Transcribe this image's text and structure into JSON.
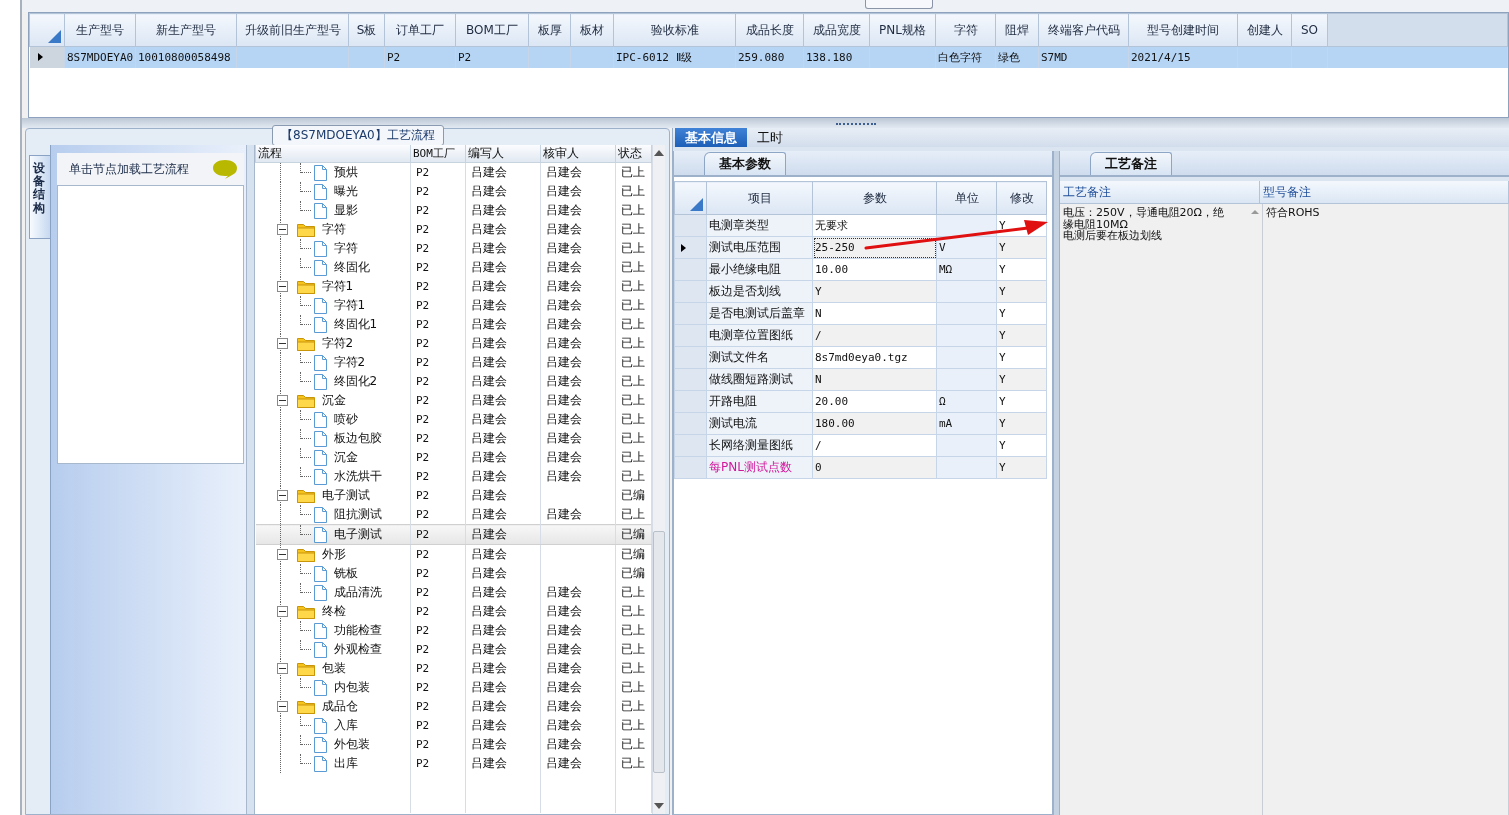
{
  "model_grid": {
    "columns": [
      "生产型号",
      "新生产型号",
      "升级前旧生产型号",
      "S板",
      "订单工厂",
      "BOM工厂",
      "板厚",
      "板材",
      "验收标准",
      "成品长度",
      "成品宽度",
      "PNL规格",
      "字符",
      "阻焊",
      "终端客户代码",
      "型号创建时间",
      "创建人",
      "SO"
    ],
    "rows": [
      {
        "selected": true,
        "cells": [
          "8S7MDOEYA0",
          "10010800058498",
          null,
          null,
          "P2",
          "P2",
          null,
          null,
          "IPC-6012 Ⅱ级",
          "259.080",
          "138.180",
          null,
          "白色字符",
          "绿色",
          "S7MD",
          "2021/4/15",
          null,
          null
        ]
      }
    ]
  },
  "process_panel": {
    "title": "【8S7MDOEYA0】工艺流程",
    "side_tab": "设备结构",
    "nav_hint": "单击节点加载工艺流程",
    "tree": {
      "columns": [
        "流程",
        "BOM工厂",
        "编写人",
        "核审人",
        "状态"
      ],
      "continued_children": [
        {
          "label": "预烘",
          "bom": "P2",
          "writer": "吕建会",
          "reviewer": "吕建会",
          "status": "已上",
          "selected": false
        },
        {
          "label": "曝光",
          "bom": "P2",
          "writer": "吕建会",
          "reviewer": "吕建会",
          "status": "已上",
          "selected": false
        },
        {
          "label": "显影",
          "bom": "P2",
          "writer": "吕建会",
          "reviewer": "吕建会",
          "status": "已上",
          "selected": false
        }
      ],
      "groups": [
        {
          "label": "字符",
          "bom": "P2",
          "writer": "吕建会",
          "reviewer": "吕建会",
          "status": "已上",
          "selected": false,
          "expanded": true,
          "children": [
            {
              "label": "字符",
              "bom": "P2",
              "writer": "吕建会",
              "reviewer": "吕建会",
              "status": "已上",
              "selected": false
            },
            {
              "label": "终固化",
              "bom": "P2",
              "writer": "吕建会",
              "reviewer": "吕建会",
              "status": "已上",
              "selected": false
            }
          ]
        },
        {
          "label": "字符1",
          "bom": "P2",
          "writer": "吕建会",
          "reviewer": "吕建会",
          "status": "已上",
          "selected": false,
          "expanded": true,
          "children": [
            {
              "label": "字符1",
              "bom": "P2",
              "writer": "吕建会",
              "reviewer": "吕建会",
              "status": "已上",
              "selected": false
            },
            {
              "label": "终固化1",
              "bom": "P2",
              "writer": "吕建会",
              "reviewer": "吕建会",
              "status": "已上",
              "selected": false
            }
          ]
        },
        {
          "label": "字符2",
          "bom": "P2",
          "writer": "吕建会",
          "reviewer": "吕建会",
          "status": "已上",
          "selected": false,
          "expanded": true,
          "children": [
            {
              "label": "字符2",
              "bom": "P2",
              "writer": "吕建会",
              "reviewer": "吕建会",
              "status": "已上",
              "selected": false
            },
            {
              "label": "终固化2",
              "bom": "P2",
              "writer": "吕建会",
              "reviewer": "吕建会",
              "status": "已上",
              "selected": false
            }
          ]
        },
        {
          "label": "沉金",
          "bom": "P2",
          "writer": "吕建会",
          "reviewer": "吕建会",
          "status": "已上",
          "selected": false,
          "expanded": true,
          "children": [
            {
              "label": "喷砂",
              "bom": "P2",
              "writer": "吕建会",
              "reviewer": "吕建会",
              "status": "已上",
              "selected": false
            },
            {
              "label": "板边包胶",
              "bom": "P2",
              "writer": "吕建会",
              "reviewer": "吕建会",
              "status": "已上",
              "selected": false
            },
            {
              "label": "沉金",
              "bom": "P2",
              "writer": "吕建会",
              "reviewer": "吕建会",
              "status": "已上",
              "selected": false
            },
            {
              "label": "水洗烘干",
              "bom": "P2",
              "writer": "吕建会",
              "reviewer": "吕建会",
              "status": "已上",
              "selected": false
            }
          ]
        },
        {
          "label": "电子测试",
          "bom": "P2",
          "writer": "吕建会",
          "status": "已编",
          "selected": false,
          "expanded": true,
          "children": [
            {
              "label": "阻抗测试",
              "bom": "P2",
              "writer": "吕建会",
              "reviewer": "吕建会",
              "status": "已上",
              "selected": false
            },
            {
              "label": "电子测试",
              "bom": "P2",
              "writer": "吕建会",
              "status": "已编",
              "selected": true
            }
          ]
        },
        {
          "label": "外形",
          "bom": "P2",
          "writer": "吕建会",
          "status": "已编",
          "selected": false,
          "expanded": true,
          "children": [
            {
              "label": "铣板",
              "bom": "P2",
              "writer": "吕建会",
              "status": "已编",
              "selected": false
            },
            {
              "label": "成品清洗",
              "bom": "P2",
              "writer": "吕建会",
              "reviewer": "吕建会",
              "status": "已上",
              "selected": false
            }
          ]
        },
        {
          "label": "终检",
          "bom": "P2",
          "writer": "吕建会",
          "reviewer": "吕建会",
          "status": "已上",
          "selected": false,
          "expanded": true,
          "children": [
            {
              "label": "功能检查",
              "bom": "P2",
              "writer": "吕建会",
              "reviewer": "吕建会",
              "status": "已上",
              "selected": false
            },
            {
              "label": "外观检查",
              "bom": "P2",
              "writer": "吕建会",
              "reviewer": "吕建会",
              "status": "已上",
              "selected": false
            }
          ]
        },
        {
          "label": "包装",
          "bom": "P2",
          "writer": "吕建会",
          "reviewer": "吕建会",
          "status": "已上",
          "selected": false,
          "expanded": true,
          "children": [
            {
              "label": "内包装",
              "bom": "P2",
              "writer": "吕建会",
              "reviewer": "吕建会",
              "status": "已上",
              "selected": false
            }
          ]
        },
        {
          "label": "成品仓",
          "bom": "P2",
          "writer": "吕建会",
          "reviewer": "吕建会",
          "status": "已上",
          "selected": false,
          "expanded": true,
          "children": [
            {
              "label": "入库",
              "bom": "P2",
              "writer": "吕建会",
              "reviewer": "吕建会",
              "status": "已上",
              "selected": false
            },
            {
              "label": "外包装",
              "bom": "P2",
              "writer": "吕建会",
              "reviewer": "吕建会",
              "status": "已上",
              "selected": false
            },
            {
              "label": "出库",
              "bom": "P2",
              "writer": "吕建会",
              "reviewer": "吕建会",
              "status": "已上",
              "selected": false
            }
          ]
        }
      ]
    }
  },
  "detail_tabs": [
    {
      "label": "基本信息",
      "selected": true
    },
    {
      "label": "工时",
      "selected": false
    }
  ],
  "params": {
    "tab": "基本参数",
    "columns": [
      "项目",
      "参数",
      "单位",
      "修改"
    ],
    "rows": [
      {
        "item": "电测章类型",
        "value": "无要求",
        "modified": "Y",
        "selected": false,
        "emphasized": false
      },
      {
        "item": "测试电压范围",
        "value": "25-250",
        "unit": "V",
        "modified": "Y",
        "selected": true,
        "emphasized": false
      },
      {
        "item": "最小绝缘电阻",
        "value": "10.00",
        "unit": "MΩ",
        "modified": "Y",
        "selected": false,
        "emphasized": false
      },
      {
        "item": "板边是否划线",
        "value": "Y",
        "modified": "Y",
        "selected": false,
        "emphasized": false
      },
      {
        "item": "是否电测试后盖章",
        "value": "N",
        "modified": "Y",
        "selected": false,
        "emphasized": false
      },
      {
        "item": "电测章位置图纸",
        "value": "/",
        "modified": "Y",
        "selected": false,
        "emphasized": false
      },
      {
        "item": "测试文件名",
        "value": "8s7md0eya0.tgz",
        "modified": "Y",
        "selected": false,
        "emphasized": false
      },
      {
        "item": "做线圈短路测试",
        "value": "N",
        "modified": "Y",
        "selected": false,
        "emphasized": false
      },
      {
        "item": "开路电阻",
        "value": "20.00",
        "unit": "Ω",
        "modified": "Y",
        "selected": false,
        "emphasized": false
      },
      {
        "item": "测试电流",
        "value": "180.00",
        "unit": "mA",
        "modified": "Y",
        "selected": false,
        "emphasized": false
      },
      {
        "item": "长网络测量图纸",
        "value": "/",
        "modified": "Y",
        "selected": false,
        "emphasized": false
      },
      {
        "item": "每PNL测试点数",
        "value": "0",
        "modified": "Y",
        "selected": false,
        "emphasized": true
      }
    ]
  },
  "remarks": {
    "tab": "工艺备注",
    "columns": [
      "工艺备注",
      "型号备注"
    ],
    "process_note": "电压：250V，导通电阻20Ω，绝缘电阻10MΩ\n电测后要在板边划线",
    "model_note": "符合ROHS"
  }
}
